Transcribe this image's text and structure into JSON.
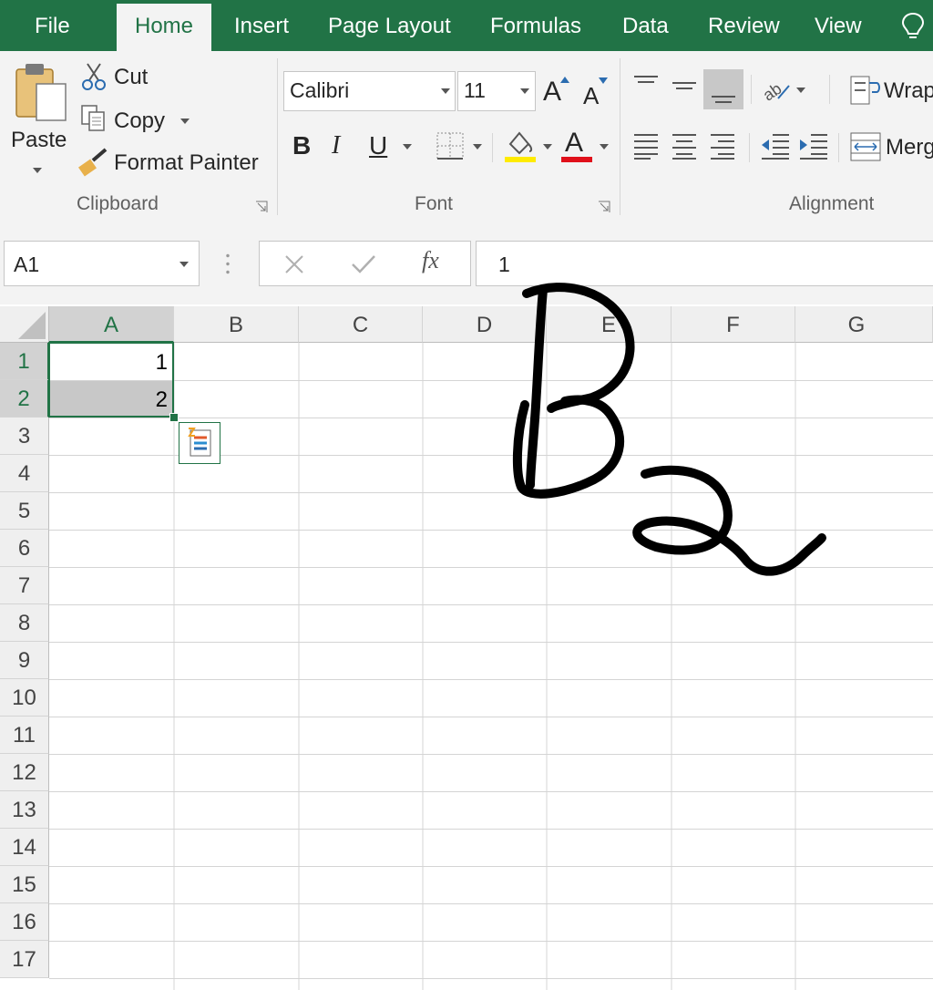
{
  "tabs": [
    "File",
    "Home",
    "Insert",
    "Page Layout",
    "Formulas",
    "Data",
    "Review",
    "View"
  ],
  "active_tab": "Home",
  "clipboard": {
    "paste": "Paste",
    "cut": "Cut",
    "copy": "Copy",
    "format_painter": "Format Painter",
    "group_label": "Clipboard"
  },
  "font": {
    "name": "Calibri",
    "size": "11",
    "bold": "B",
    "italic": "I",
    "underline": "U",
    "font_color_glyph": "A",
    "grow_glyph": "A",
    "shrink_glyph": "A",
    "group_label": "Font",
    "highlight_color": "#ffeb00",
    "text_color": "#e0101a"
  },
  "alignment": {
    "wrap": "Wrap",
    "merge": "Merg",
    "group_label": "Alignment"
  },
  "formula_bar": {
    "name_box": "A1",
    "fx": "fx",
    "value": "1"
  },
  "columns": [
    "A",
    "B",
    "C",
    "D",
    "E",
    "F",
    "G"
  ],
  "rows": [
    "1",
    "2",
    "3",
    "4",
    "5",
    "6",
    "7",
    "8",
    "9",
    "10",
    "11",
    "12",
    "13",
    "14",
    "15",
    "16",
    "17"
  ],
  "cells": {
    "A1": "1",
    "A2": "2"
  },
  "selected_range": "A1:A2",
  "colors": {
    "accent": "#217346",
    "ribbon_bg": "#f3f3f3",
    "header_bg": "#efefef",
    "selection_fill": "#c8c8c8",
    "ink": "#000000"
  }
}
